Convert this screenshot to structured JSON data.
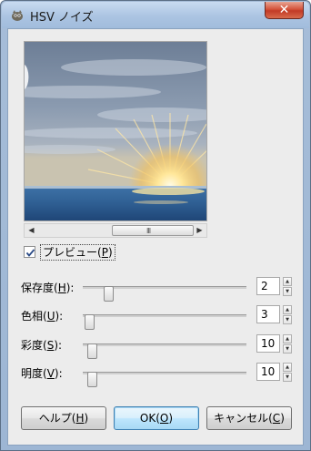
{
  "window": {
    "title": "HSV ノイズ",
    "icon": "gimp-wilber-icon",
    "close_glyph": "✕"
  },
  "preview": {
    "image": "sunset-over-sea-preview",
    "scroll_grip": "III",
    "checkbox_checked": true,
    "checkbox_label": "プレビュー(",
    "checkbox_mnemonic": "P",
    "checkbox_label_end": ")"
  },
  "params": [
    {
      "label": "保存度(",
      "mnemonic": "H",
      "label_end": "):",
      "value": "2",
      "slider_fraction": 0.13
    },
    {
      "label": "色相(",
      "mnemonic": "U",
      "label_end": "):",
      "value": "3",
      "slider_fraction": 0.03
    },
    {
      "label": "彩度(",
      "mnemonic": "S",
      "label_end": "):",
      "value": "10",
      "slider_fraction": 0.04
    },
    {
      "label": "明度(",
      "mnemonic": "V",
      "label_end": "):",
      "value": "10",
      "slider_fraction": 0.04
    }
  ],
  "buttons": {
    "help": {
      "label": "ヘルプ(",
      "mnemonic": "H",
      "label_end": ")"
    },
    "ok": {
      "label": "OK(",
      "mnemonic": "O",
      "label_end": ")"
    },
    "cancel": {
      "label": "キャンセル(",
      "mnemonic": "C",
      "label_end": ")"
    }
  },
  "colors": {
    "close_red": "#c23b26",
    "default_button_border": "#3c7fb1"
  }
}
